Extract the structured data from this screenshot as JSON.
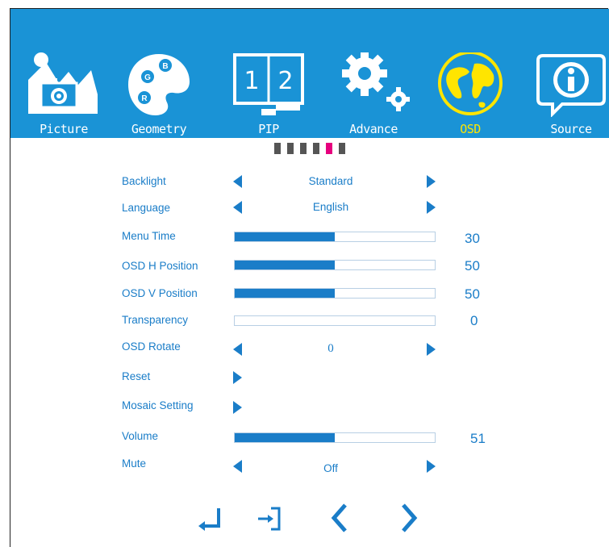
{
  "colors": {
    "header_bg": "#1a93d6",
    "accent": "#1a7dc8",
    "active_tab": "#ffe500",
    "active_dot": "#e6007e"
  },
  "tabs": [
    {
      "label": "Picture",
      "icon": "picture-icon"
    },
    {
      "label": "Geometry",
      "icon": "palette-icon"
    },
    {
      "label": "PIP",
      "icon": "pip-icon"
    },
    {
      "label": "Advance",
      "icon": "gears-icon"
    },
    {
      "label": "OSD",
      "icon": "globe-icon",
      "active": true
    },
    {
      "label": "Source",
      "icon": "info-icon"
    }
  ],
  "page_indicator": {
    "total": 6,
    "active_index": 4
  },
  "menu": {
    "backlight": {
      "label": "Backlight",
      "value": "Standard"
    },
    "language": {
      "label": "Language",
      "value": "English"
    },
    "menu_time": {
      "label": "Menu Time",
      "value": "30",
      "level": 0.5
    },
    "osd_h_position": {
      "label": "OSD H Position",
      "value": "50",
      "level": 0.5
    },
    "osd_v_position": {
      "label": "OSD V Position",
      "value": "50",
      "level": 0.5
    },
    "transparency": {
      "label": "Transparency",
      "value": "0",
      "level": 0
    },
    "osd_rotate": {
      "label": "OSD Rotate",
      "value": "0"
    },
    "reset": {
      "label": "Reset"
    },
    "mosaic_setting": {
      "label": "Mosaic Setting"
    },
    "volume": {
      "label": "Volume",
      "value": "51",
      "level": 0.5
    },
    "mute": {
      "label": "Mute",
      "value": "Off"
    }
  },
  "bottom_nav": [
    "enter-icon",
    "exit-icon",
    "left-chevron-icon",
    "right-chevron-icon"
  ]
}
